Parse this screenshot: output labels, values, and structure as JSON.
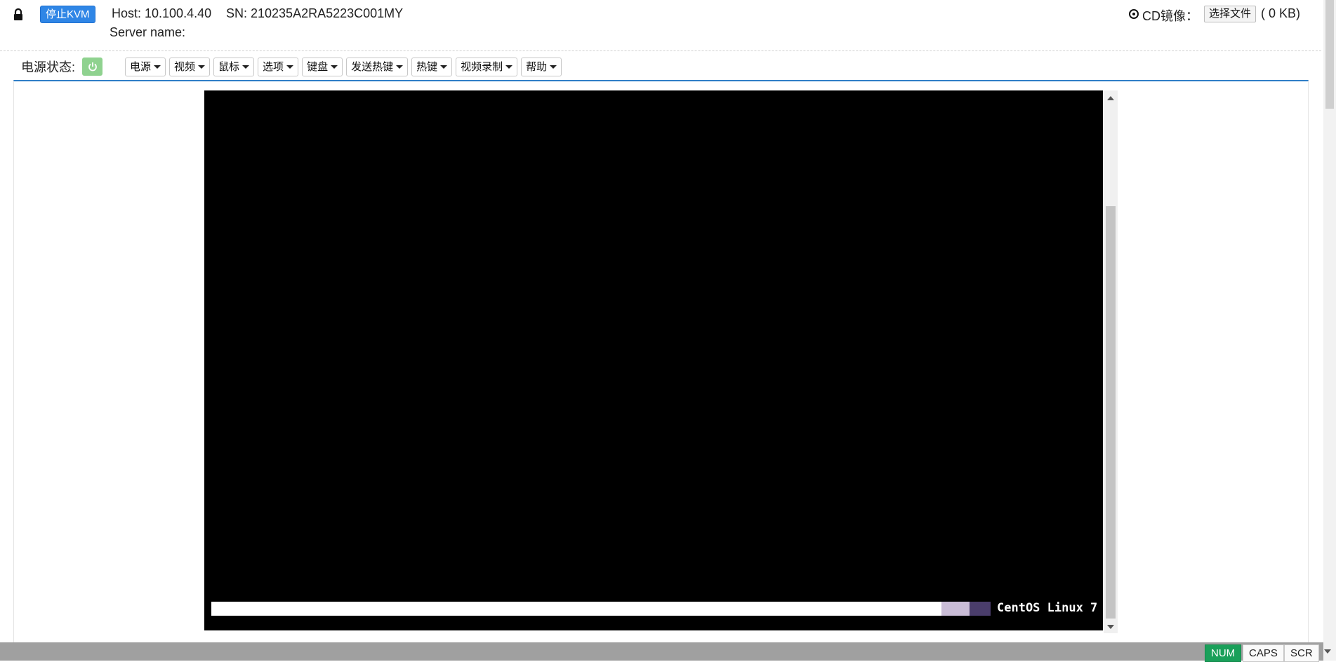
{
  "header": {
    "stop_kvm_label": "停止KVM",
    "host": "Host: 10.100.4.40",
    "sn": "SN: 210235A2RA5223C001MY",
    "server_name": "Server name:",
    "cd_label": "CD镜像：",
    "choose_file_label": "选择文件",
    "file_size": "( 0 KB)"
  },
  "toolbar": {
    "power_status_label": "电源状态:",
    "menus": [
      "电源",
      "视频",
      "鼠标",
      "选项",
      "键盘",
      "发送热键",
      "热键",
      "视频录制",
      "帮助"
    ]
  },
  "console": {
    "boot_text": "CentOS Linux 7",
    "background": "#000000"
  },
  "statusbar": {
    "keys": [
      "NUM",
      "CAPS",
      "SCR"
    ],
    "active": "NUM"
  },
  "colors": {
    "accent": "#2f86e6",
    "power_on": "#8fd28f",
    "num_active": "#1aa05a",
    "panel_border": "#2f7ec7"
  }
}
